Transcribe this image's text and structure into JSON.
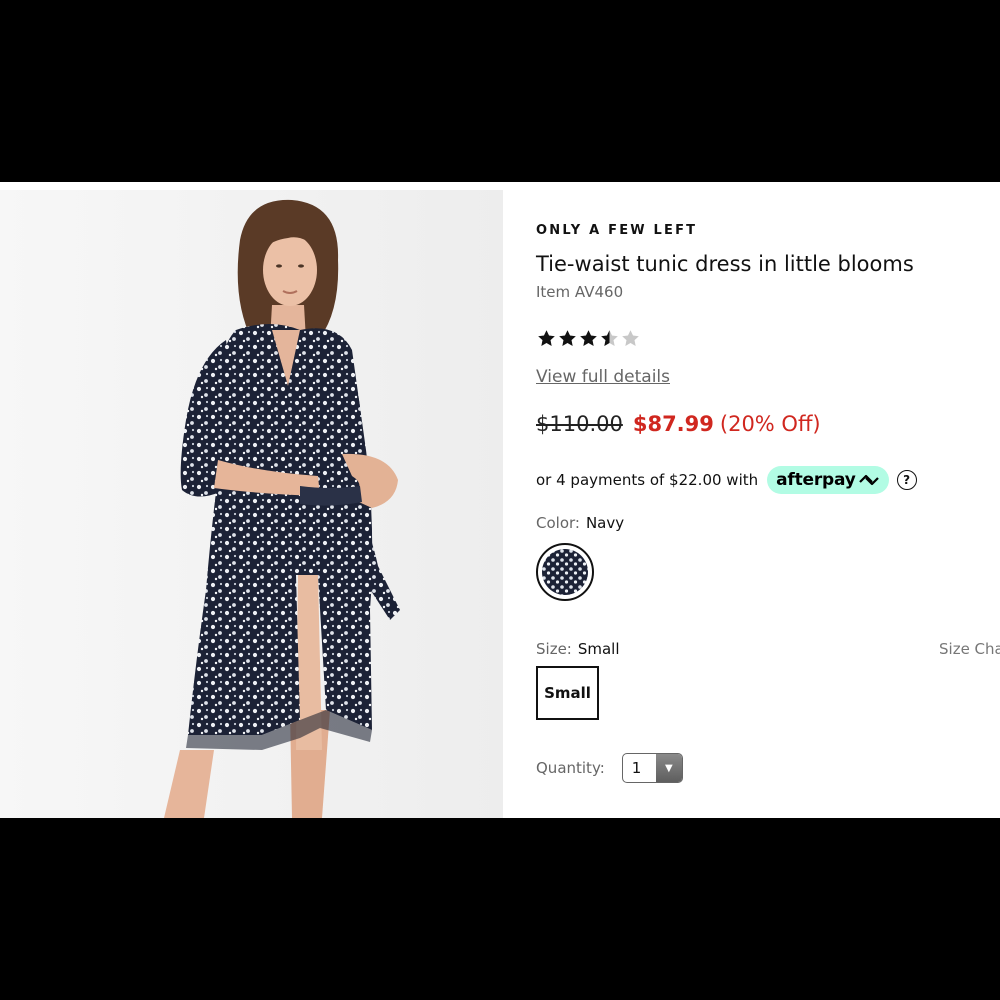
{
  "product": {
    "stock_notice": "ONLY A FEW LEFT",
    "title": "Tie-waist tunic dress in little blooms",
    "item_number": "Item AV460",
    "rating": 3.5,
    "rating_max": 5,
    "star_icon": "star-icon",
    "view_details_label": "View full details",
    "price_original": "$110.00",
    "price_sale": "$87.99",
    "discount": "(20% Off)",
    "installments_text": "or 4 payments of $22.00 with",
    "afterpay_label": "afterpay",
    "afterpay_icon": "afterpay-arrows-icon",
    "help_icon": "question-circle-icon"
  },
  "color": {
    "label": "Color:",
    "value": "Navy"
  },
  "size": {
    "label": "Size:",
    "value": "Small",
    "chart_label": "Size Chart",
    "options": [
      "Small"
    ]
  },
  "quantity": {
    "label": "Quantity:",
    "value": "1",
    "arrow_icon": "chevron-down-icon"
  },
  "colors": {
    "sale_red": "#d0271f",
    "afterpay_mint": "#b2fce4",
    "background": "#000000",
    "dress_navy": "#1c2236"
  }
}
